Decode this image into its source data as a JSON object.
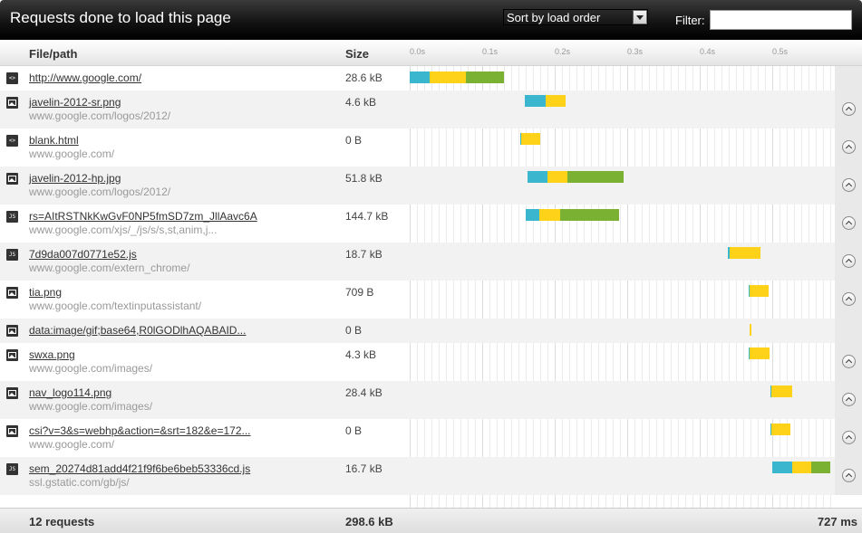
{
  "header": {
    "title": "Requests done to load this page",
    "sort_value": "Sort by load order",
    "filter_label": "Filter:",
    "filter_value": ""
  },
  "columns": {
    "file": "File/path",
    "size": "Size",
    "ticks": [
      "0.0s",
      "0.1s",
      "0.2s",
      "0.3s",
      "0.4s",
      "0.5s"
    ]
  },
  "colors": {
    "dns": "#3ab7cf",
    "wait": "#ffd21a",
    "receive": "#7bb133"
  },
  "requests": [
    {
      "name": "http://www.google.com/",
      "path": "",
      "size": "28.6 kB",
      "type": "html-icon",
      "segments": [
        {
          "phase": "dns",
          "start": 0,
          "end": 0.028
        },
        {
          "phase": "wait",
          "start": 0.028,
          "end": 0.078
        },
        {
          "phase": "receive",
          "start": 0.078,
          "end": 0.13
        }
      ]
    },
    {
      "name": "javelin-2012-sr.png",
      "path": "www.google.com/logos/2012/",
      "size": "4.6 kB",
      "type": "image-icon",
      "segments": [
        {
          "phase": "dns",
          "start": 0.159,
          "end": 0.188
        },
        {
          "phase": "wait",
          "start": 0.188,
          "end": 0.215
        }
      ]
    },
    {
      "name": "blank.html",
      "path": "www.google.com/",
      "size": "0 B",
      "type": "html-icon",
      "segments": [
        {
          "phase": "dns",
          "start": 0.152,
          "end": 0.154
        },
        {
          "phase": "wait",
          "start": 0.154,
          "end": 0.18
        }
      ]
    },
    {
      "name": "javelin-2012-hp.jpg",
      "path": "www.google.com/logos/2012/",
      "size": "51.8 kB",
      "type": "image-icon",
      "segments": [
        {
          "phase": "dns",
          "start": 0.162,
          "end": 0.19
        },
        {
          "phase": "wait",
          "start": 0.19,
          "end": 0.218
        },
        {
          "phase": "receive",
          "start": 0.218,
          "end": 0.295
        }
      ]
    },
    {
      "name": "rs=AItRSTNkKwGvF0NP5fmSD7zm_JllAavc6A",
      "path": "www.google.com/xjs/_/js/s/s,st,anim,j...",
      "size": "144.7 kB",
      "type": "js-icon",
      "segments": [
        {
          "phase": "dns",
          "start": 0.16,
          "end": 0.179
        },
        {
          "phase": "wait",
          "start": 0.179,
          "end": 0.208
        },
        {
          "phase": "receive",
          "start": 0.208,
          "end": 0.289
        }
      ]
    },
    {
      "name": "7d9da007d0771e52.js",
      "path": "www.google.com/extern_chrome/",
      "size": "18.7 kB",
      "type": "js-icon",
      "segments": [
        {
          "phase": "dns",
          "start": 0.439,
          "end": 0.441
        },
        {
          "phase": "wait",
          "start": 0.441,
          "end": 0.484
        }
      ]
    },
    {
      "name": "tia.png",
      "path": "www.google.com/textinputassistant/",
      "size": "709 B",
      "type": "image-icon",
      "segments": [
        {
          "phase": "dns",
          "start": 0.467,
          "end": 0.469
        },
        {
          "phase": "wait",
          "start": 0.469,
          "end": 0.495
        }
      ]
    },
    {
      "name": "data:image/gif;base64,R0lGODlhAQABAID...",
      "path": "",
      "size": "0 B",
      "type": "image-icon",
      "segments": [
        {
          "phase": "wait",
          "start": 0.469,
          "end": 0.471
        }
      ]
    },
    {
      "name": "swxa.png",
      "path": "www.google.com/images/",
      "size": "4.3 kB",
      "type": "image-icon",
      "segments": [
        {
          "phase": "dns",
          "start": 0.467,
          "end": 0.469
        },
        {
          "phase": "wait",
          "start": 0.469,
          "end": 0.496
        }
      ]
    },
    {
      "name": "nav_logo114.png",
      "path": "www.google.com/images/",
      "size": "28.4 kB",
      "type": "image-icon",
      "segments": [
        {
          "phase": "dns",
          "start": 0.497,
          "end": 0.499
        },
        {
          "phase": "wait",
          "start": 0.499,
          "end": 0.527
        }
      ]
    },
    {
      "name": "csi?v=3&s=webhp&action=&srt=182&e=172...",
      "path": "www.google.com/",
      "size": "0 B",
      "type": "image-icon",
      "segments": [
        {
          "phase": "dns",
          "start": 0.497,
          "end": 0.499
        },
        {
          "phase": "wait",
          "start": 0.499,
          "end": 0.525
        }
      ]
    },
    {
      "name": "sem_20274d81add4f21f9f6be6beb53336cd.js",
      "path": "ssl.gstatic.com/gb/js/",
      "size": "16.7 kB",
      "type": "js-icon",
      "segments": [
        {
          "phase": "dns",
          "start": 0.5,
          "end": 0.527
        },
        {
          "phase": "wait",
          "start": 0.527,
          "end": 0.554
        },
        {
          "phase": "receive",
          "start": 0.554,
          "end": 0.58
        }
      ]
    }
  ],
  "footer": {
    "requests": "12 requests",
    "total_size": "298.6 kB",
    "total_time": "727 ms"
  }
}
